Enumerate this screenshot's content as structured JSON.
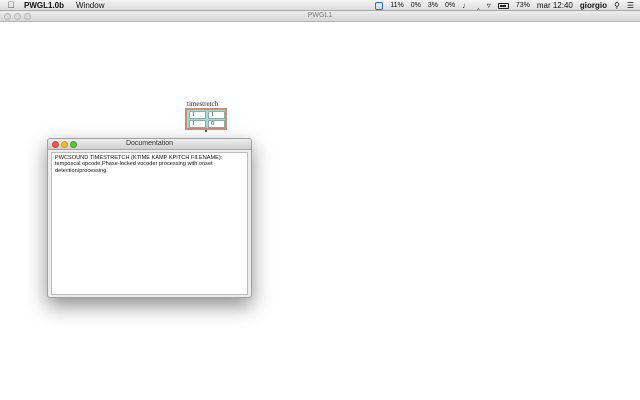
{
  "menubar": {
    "app_name": "PWGL1.0b",
    "items": [
      "Window"
    ],
    "status": {
      "cpu1": "11%",
      "cpu2": "0%",
      "cpu3": "3%",
      "cpu4": "0%",
      "battery": "73%",
      "clock": "mar 12:40",
      "user": "giorgio"
    }
  },
  "main_window": {
    "title": "PWGL1"
  },
  "patch_box": {
    "label": "timestretch",
    "cells": [
      "1",
      "1",
      "1",
      "0"
    ]
  },
  "doc_window": {
    "title": "Documentation",
    "line1": "PWCSOUND TIMESTRETCH   (KTIME KAMP KPITCH FILENAME):",
    "line2": "temposcal opcode,Phase-locked vocoder processing with onset",
    "line3": "detection/processing."
  }
}
